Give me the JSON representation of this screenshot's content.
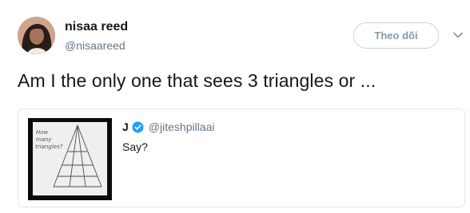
{
  "author": {
    "name": "nisaa reed",
    "handle": "@nisaareed",
    "avatar_icon": "profile-photo"
  },
  "follow_button": {
    "label": "Theo dõi"
  },
  "menu_icon": "chevron-down-icon",
  "tweet": {
    "text": "Am I the only one that sees 3 triangles or ..."
  },
  "quoted_tweet": {
    "name": "J",
    "verified": true,
    "handle": "@jiteshpillaai",
    "text": "Say?",
    "media": {
      "icon": "triangle-puzzle-image",
      "handwritten_text": "How many triangles?"
    }
  },
  "colors": {
    "text_primary": "#14171a",
    "text_secondary": "#657786",
    "verified_blue": "#1da1f2",
    "border": "#e1e8ed"
  }
}
